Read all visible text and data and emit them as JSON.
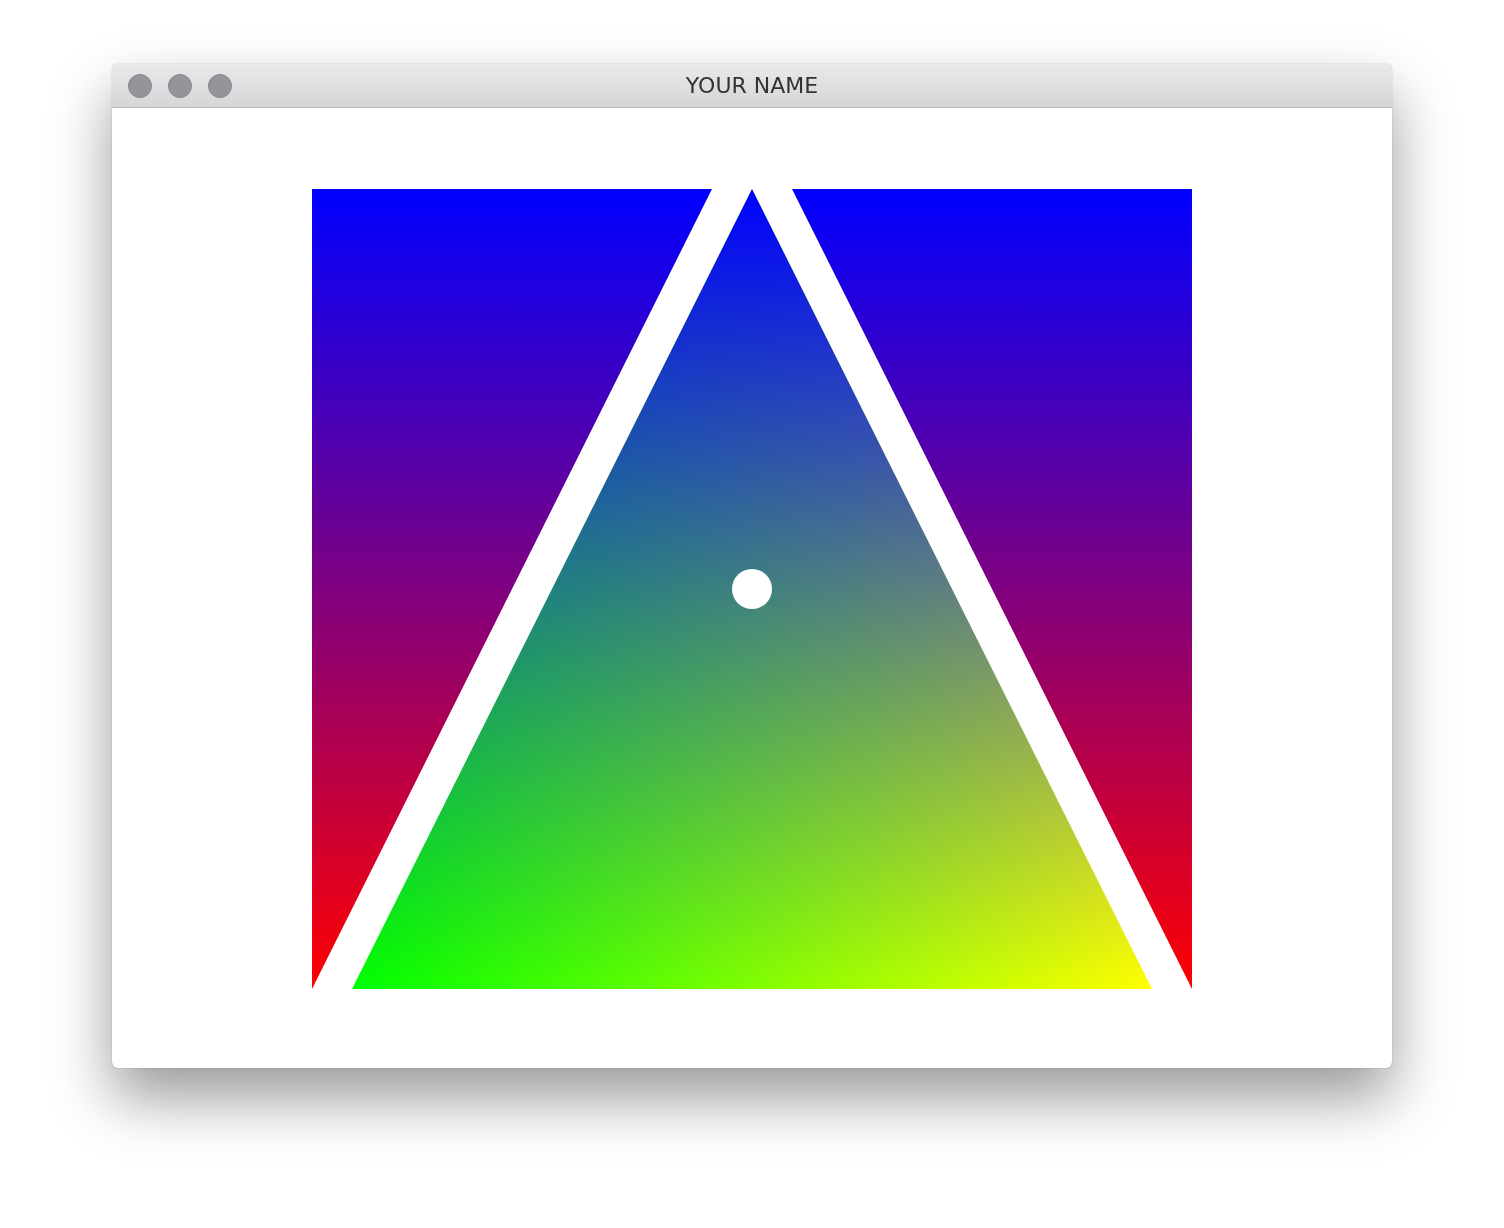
{
  "window": {
    "title": "YOUR NAME"
  }
}
